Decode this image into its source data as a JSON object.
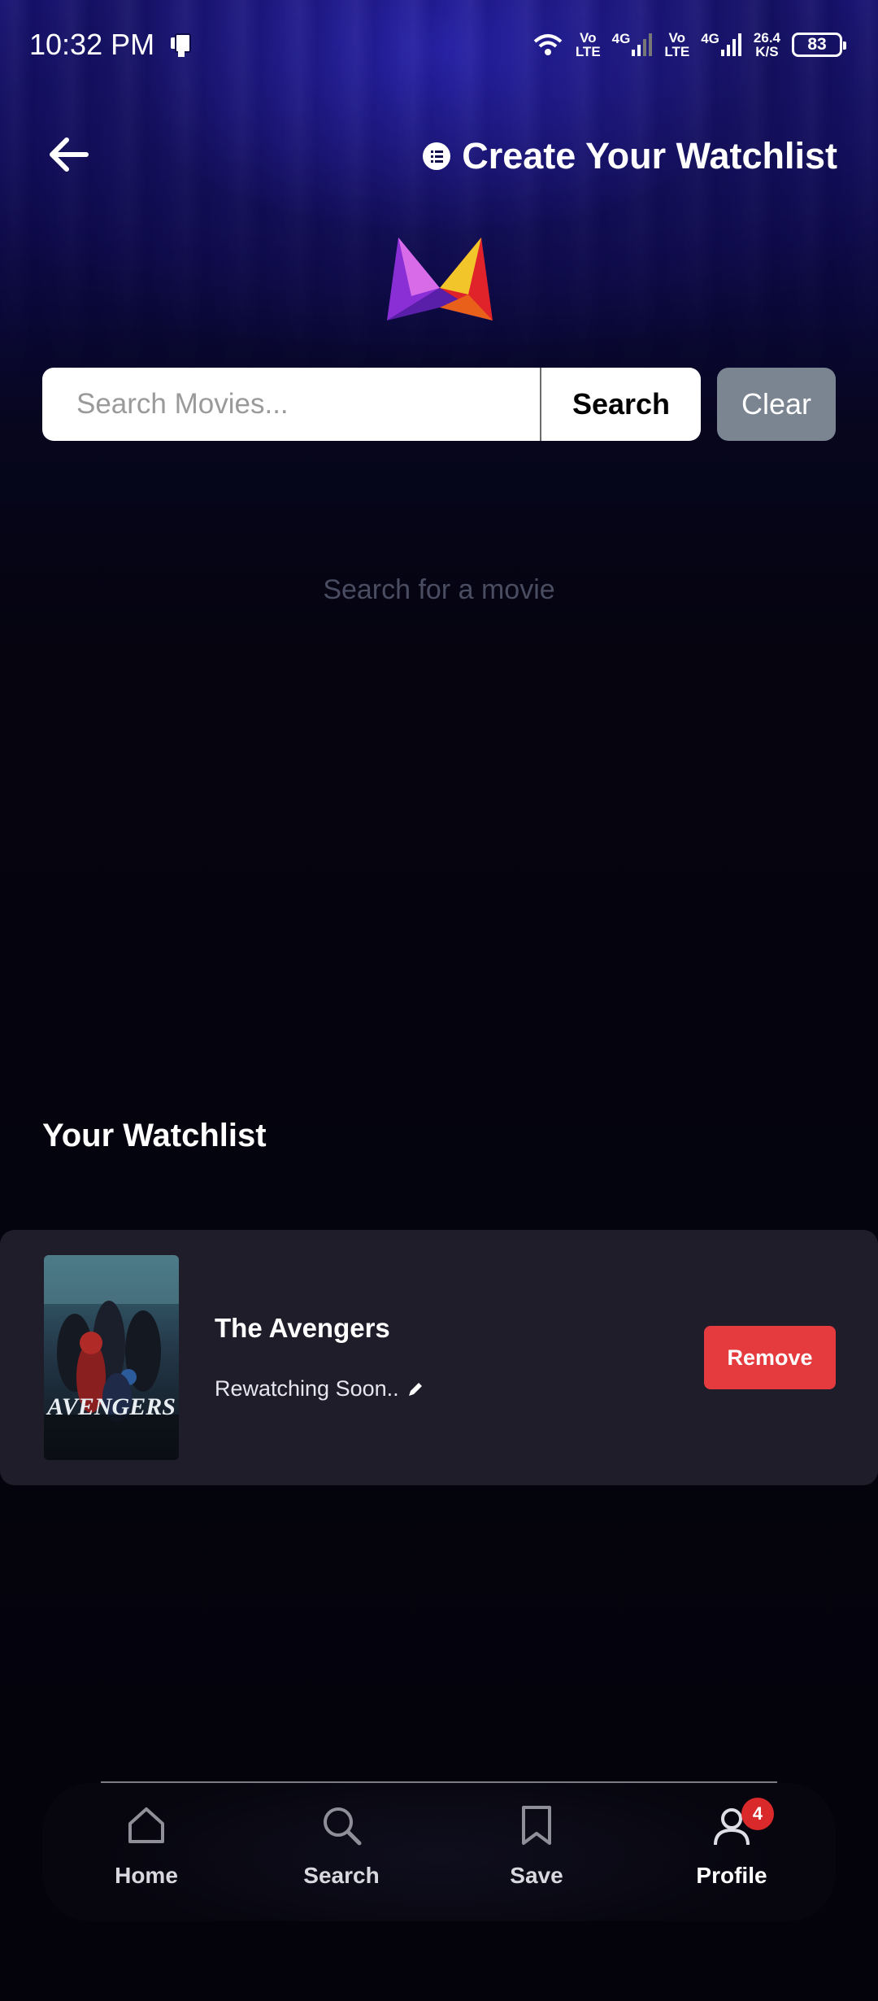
{
  "status_bar": {
    "time": "10:32 PM",
    "network_1": "Vo\nLTE",
    "net_type_1": "4G",
    "network_2": "Vo\nLTE",
    "net_type_2": "4G",
    "speed_value": "26.4",
    "speed_unit": "K/S",
    "battery": "83"
  },
  "header": {
    "title": "Create Your Watchlist",
    "back_icon": "arrow-left-icon",
    "title_icon": "list-icon"
  },
  "search": {
    "placeholder": "Search Movies...",
    "value": "",
    "search_label": "Search",
    "clear_label": "Clear",
    "empty_message": "Search for a movie"
  },
  "watchlist": {
    "title": "Your Watchlist",
    "items": [
      {
        "title": "The Avengers",
        "note": "Rewatching Soon..",
        "poster_text": "AVENGERS",
        "remove_label": "Remove"
      }
    ]
  },
  "nav": {
    "items": [
      {
        "label": "Home",
        "icon": "home-icon"
      },
      {
        "label": "Search",
        "icon": "search-icon"
      },
      {
        "label": "Save",
        "icon": "bookmark-icon"
      },
      {
        "label": "Profile",
        "icon": "user-icon",
        "badge": "4",
        "active": true
      }
    ]
  },
  "colors": {
    "accent_remove": "#e53b3f",
    "clear_button": "#7a8591",
    "card": "#1e1d29",
    "badge": "#d9292b"
  }
}
